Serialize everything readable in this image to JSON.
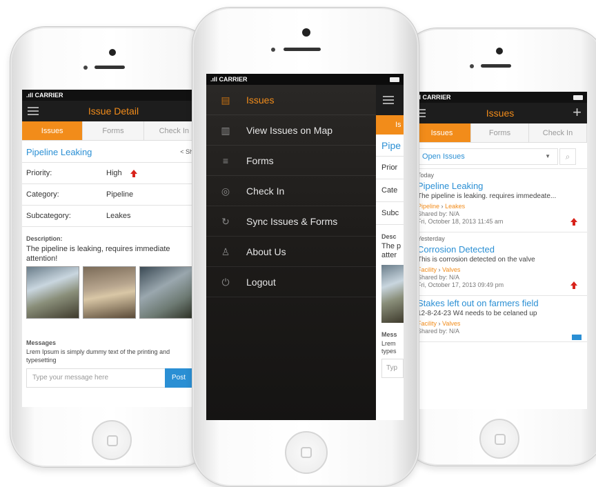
{
  "carrier": "CARRIER",
  "left": {
    "title": "Issue Detail",
    "tabs": [
      "Issues",
      "Forms",
      "Check In"
    ],
    "issue_title": "Pipeline Leaking",
    "share": "Share",
    "rows": [
      {
        "label": "Priority:",
        "value": "High"
      },
      {
        "label": "Category:",
        "value": "Pipeline"
      },
      {
        "label": "Subcategory:",
        "value": "Leakes"
      }
    ],
    "description_label": "Description:",
    "description": "The pipeline is leaking, requires immediate attention!",
    "messages_label": "Messages",
    "message_text": "Lrem Ipsum is simply dummy text of the printing and typesetting",
    "message_placeholder": "Type your message here",
    "post_label": "Post"
  },
  "center": {
    "menu": [
      {
        "label": "Issues",
        "icon": "document-icon"
      },
      {
        "label": "View Issues on Map",
        "icon": "map-icon"
      },
      {
        "label": "Forms",
        "icon": "list-icon"
      },
      {
        "label": "Check In",
        "icon": "pin-icon"
      },
      {
        "label": "Sync Issues & Forms",
        "icon": "sync-icon"
      },
      {
        "label": "About Us",
        "icon": "user-icon"
      },
      {
        "label": "Logout",
        "icon": "power-icon"
      }
    ],
    "peek": {
      "tab": "Is",
      "title": "Pipe",
      "rows": [
        "Prior",
        "Cate",
        "Subc"
      ],
      "desc": [
        "Desc",
        "The p",
        "atter"
      ],
      "messages": [
        "Mess",
        "Lrem",
        "types"
      ],
      "input": "Typ"
    }
  },
  "right": {
    "title": "Issues",
    "tabs": [
      "Issues",
      "Forms",
      "Check In"
    ],
    "filter": "Open Issues",
    "groups": [
      {
        "header": "Today",
        "items": [
          {
            "title": "Pipeline Leaking",
            "desc": "The pipeline is leaking. requires immedeate...",
            "cat": "Pipeline",
            "sub": "Leakes",
            "shared": "Shared by: N/A",
            "date": "Fri, October 18, 2013   11:45 am",
            "priority": "high"
          }
        ]
      },
      {
        "header": "Yesterday",
        "items": [
          {
            "title": "Corrosion Detected",
            "desc": "This is corrosion detected on the valve",
            "cat": "Facility",
            "sub": "Valves",
            "shared": "Shared by: N/A",
            "date": "Fri, October 17, 2013   09:49 pm",
            "priority": "high"
          },
          {
            "title": "Stakes left out on farmers field",
            "desc": "12-8-24-23 W4 needs to be celaned up",
            "cat": "Facility",
            "sub": "Valves",
            "shared": "Shared by: N/A",
            "date": "",
            "priority": "normal"
          }
        ]
      }
    ]
  },
  "colors": {
    "accent": "#f28c1a",
    "link": "#2a8fd4",
    "nav": "#1d1d1d",
    "post": "#2a8fd4",
    "priority_high": "#d8231b"
  }
}
